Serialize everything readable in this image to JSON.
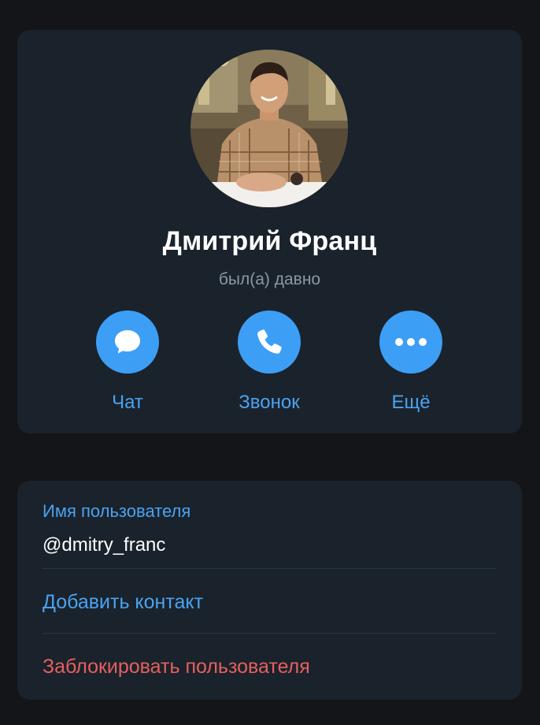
{
  "profile": {
    "name": "Дмитрий Франц",
    "status": "был(а) давно"
  },
  "actions": {
    "chat": {
      "label": "Чат",
      "icon": "chat-bubble-icon"
    },
    "call": {
      "label": "Звонок",
      "icon": "phone-icon"
    },
    "more": {
      "label": "Ещё",
      "icon": "more-dots-icon"
    }
  },
  "info": {
    "username_caption": "Имя пользователя",
    "username_value": "@dmitry_franc",
    "add_contact_label": "Добавить контакт",
    "block_user_label": "Заблокировать пользователя"
  },
  "colors": {
    "background": "#141518",
    "card": "#1a222c",
    "accent": "#3d9ef5",
    "link": "#4aa3f0",
    "danger": "#e5605d",
    "muted": "#8b98a6"
  }
}
